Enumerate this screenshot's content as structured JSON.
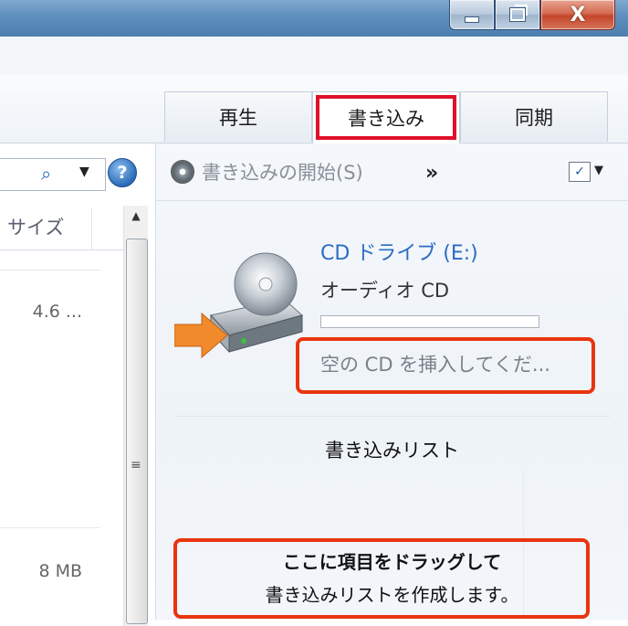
{
  "window": {
    "minimize_icon": "minimize-icon",
    "maximize_icon": "restore-icon",
    "close_label": "X"
  },
  "tabs": [
    {
      "label": "再生"
    },
    {
      "label": "書き込み",
      "selected": true
    },
    {
      "label": "同期"
    }
  ],
  "left_pane": {
    "search_icon": "search-icon",
    "help_label": "?",
    "column_header": "サイズ",
    "rows": [
      {
        "size": "4.6 ..."
      },
      {
        "size": "8 MB"
      }
    ]
  },
  "burn_pane": {
    "start_burn_label": "書き込みの開始(S)",
    "more_label": "»",
    "drive_name": "CD ドライブ (E:)",
    "drive_type": "オーディオ CD",
    "drive_status": "空の CD を挿入してくだ...",
    "list_title": "書き込みリスト",
    "drop_hint_line1": "ここに項目をドラッグして",
    "drop_hint_line2": "書き込みリストを作成します。"
  },
  "colors": {
    "highlight_red": "#e8350f",
    "link_blue": "#2c6cc4"
  }
}
